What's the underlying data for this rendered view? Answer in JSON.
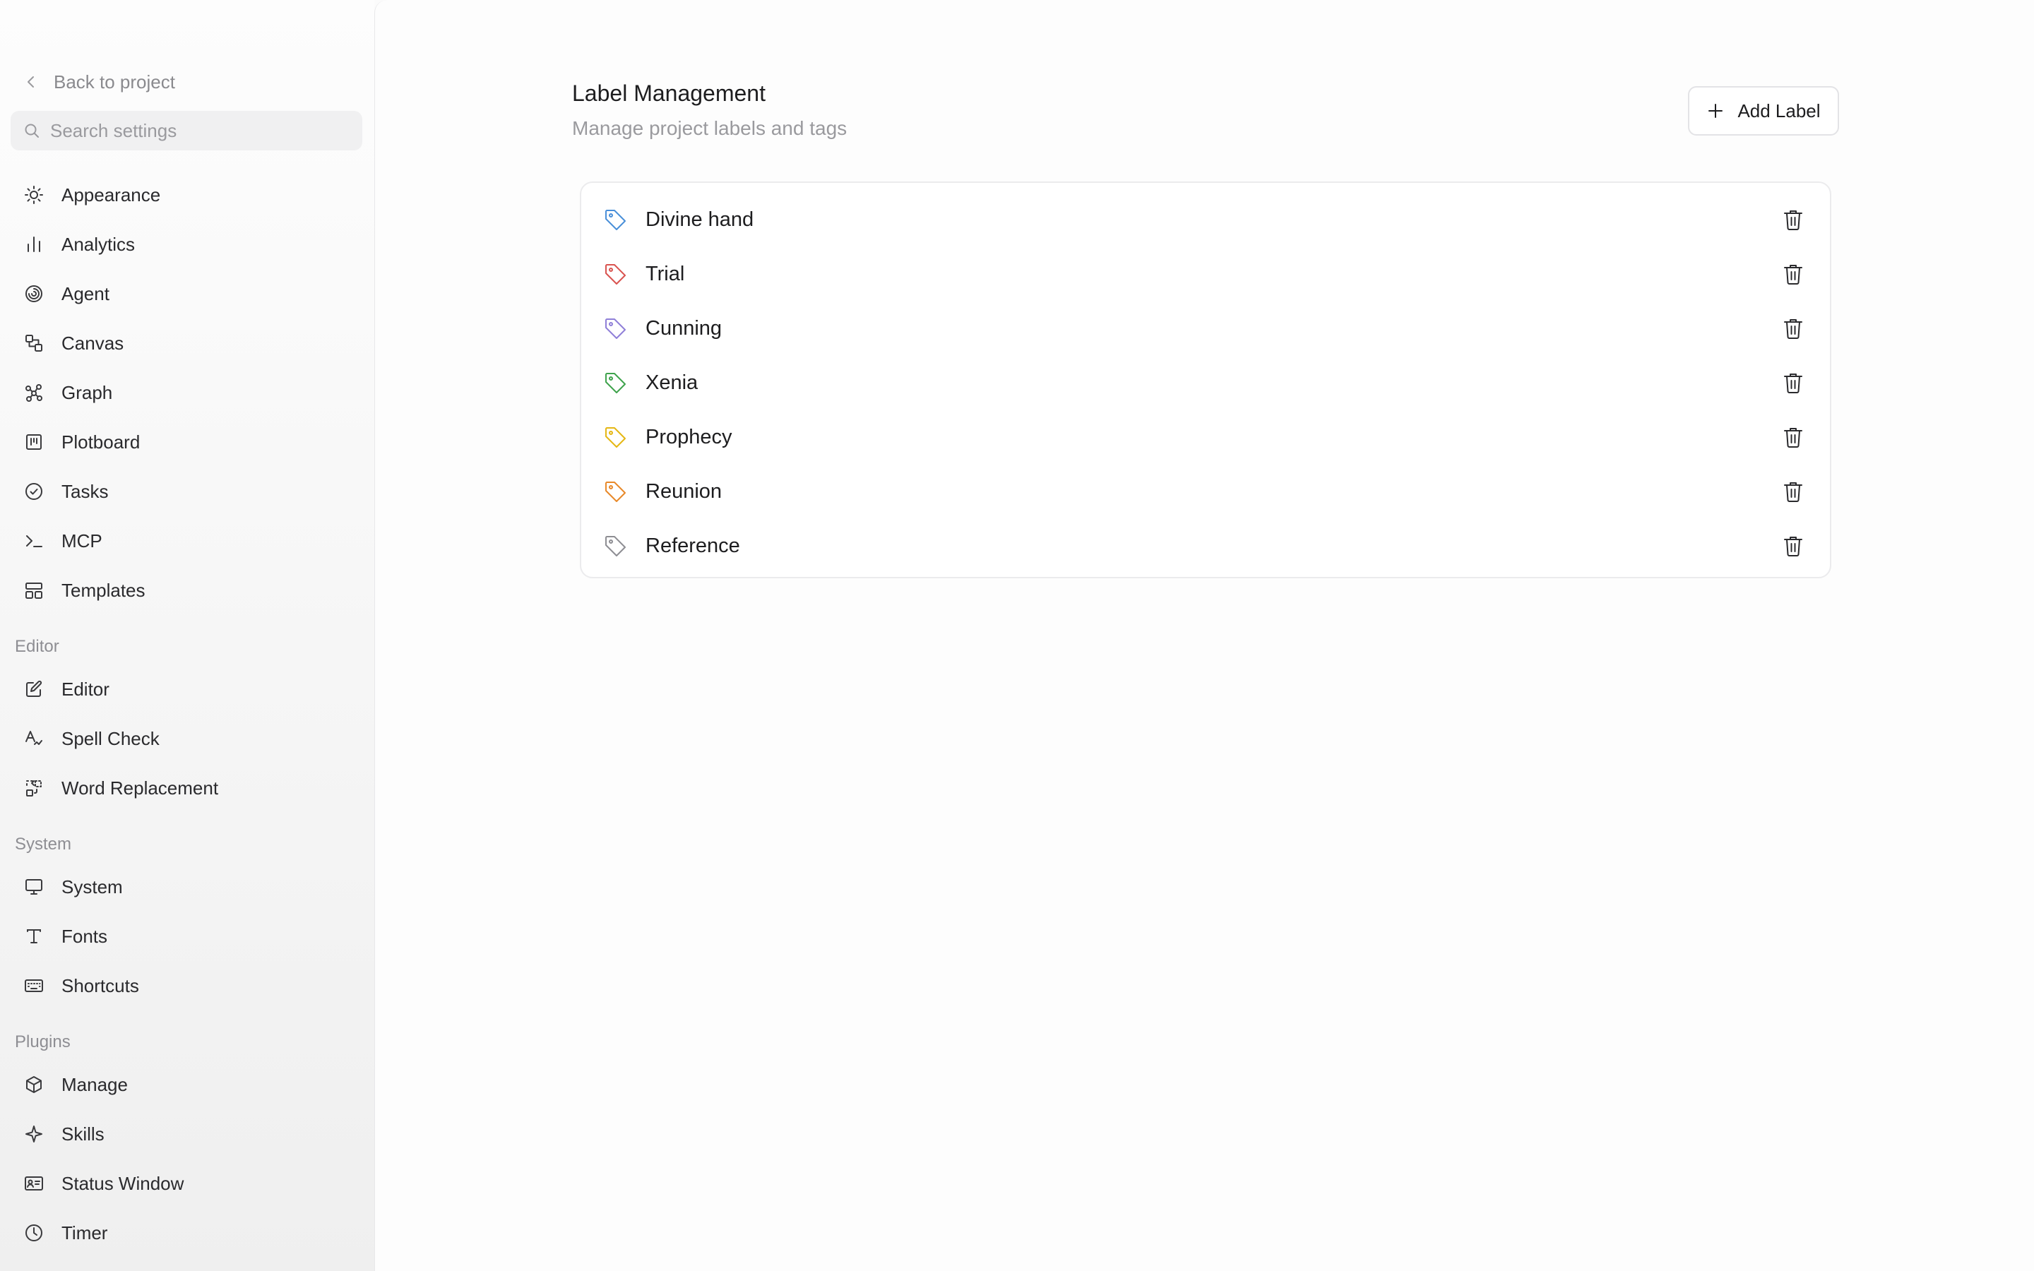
{
  "sidebar": {
    "back_label": "Back to project",
    "search_placeholder": "Search settings",
    "general_items": [
      {
        "label": "Appearance",
        "icon": "sun-icon"
      },
      {
        "label": "Analytics",
        "icon": "bar-chart-icon"
      },
      {
        "label": "Agent",
        "icon": "spiral-icon"
      },
      {
        "label": "Canvas",
        "icon": "shapes-icon"
      },
      {
        "label": "Graph",
        "icon": "graph-nodes-icon"
      },
      {
        "label": "Plotboard",
        "icon": "kanban-icon"
      },
      {
        "label": "Tasks",
        "icon": "check-circle-icon"
      },
      {
        "label": "MCP",
        "icon": "terminal-icon"
      },
      {
        "label": "Templates",
        "icon": "layout-icon"
      }
    ],
    "sections": [
      {
        "title": "Editor",
        "items": [
          {
            "label": "Editor",
            "icon": "edit-icon"
          },
          {
            "label": "Spell Check",
            "icon": "spell-check-icon"
          },
          {
            "label": "Word Replacement",
            "icon": "replace-icon"
          }
        ]
      },
      {
        "title": "System",
        "items": [
          {
            "label": "System",
            "icon": "monitor-icon"
          },
          {
            "label": "Fonts",
            "icon": "type-icon"
          },
          {
            "label": "Shortcuts",
            "icon": "keyboard-icon"
          }
        ]
      },
      {
        "title": "Plugins",
        "items": [
          {
            "label": "Manage",
            "icon": "package-icon"
          },
          {
            "label": "Skills",
            "icon": "sparkle-icon"
          },
          {
            "label": "Status Window",
            "icon": "id-card-icon"
          },
          {
            "label": "Timer",
            "icon": "clock-icon"
          }
        ]
      }
    ]
  },
  "main": {
    "title": "Label Management",
    "subtitle": "Manage project labels and tags",
    "add_button_label": "Add Label",
    "labels": [
      {
        "name": "Divine hand",
        "color": "#4a8fd9"
      },
      {
        "name": "Trial",
        "color": "#d9534f"
      },
      {
        "name": "Cunning",
        "color": "#8f7fd8"
      },
      {
        "name": "Xenia",
        "color": "#3fa34d"
      },
      {
        "name": "Prophecy",
        "color": "#e5b714"
      },
      {
        "name": "Reunion",
        "color": "#e8892a"
      },
      {
        "name": "Reference",
        "color": "#8e8e93"
      }
    ]
  },
  "colors": {
    "text_primary": "#1d1d1f",
    "text_muted": "#9a9a9e",
    "border": "#ebebed"
  }
}
